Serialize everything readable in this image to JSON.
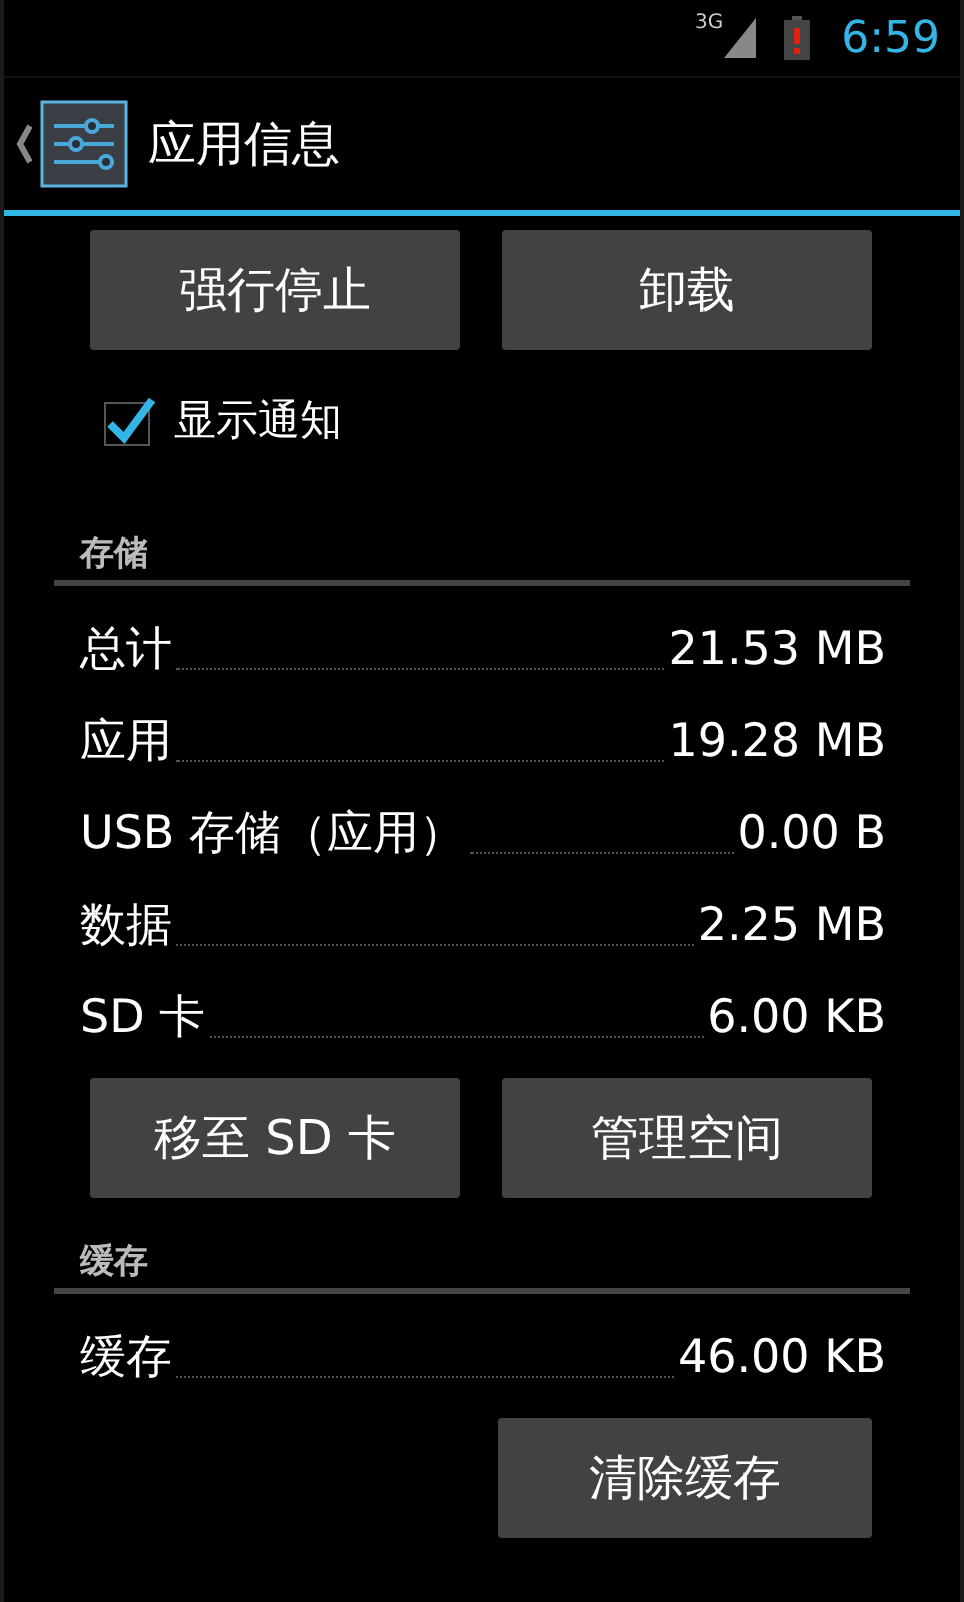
{
  "status_bar": {
    "network": "3G",
    "time": "6:59"
  },
  "action_bar": {
    "title": "应用信息"
  },
  "top_buttons": [
    {
      "label": "强行停止"
    },
    {
      "label": "卸载"
    }
  ],
  "notification_checkbox": {
    "label": "显示通知",
    "checked": true
  },
  "storage": {
    "header": "存储",
    "rows": [
      {
        "label": "总计",
        "value": "21.53 MB"
      },
      {
        "label": "应用",
        "value": "19.28 MB"
      },
      {
        "label": "USB 存储（应用）",
        "value": "0.00 B"
      },
      {
        "label": "数据",
        "value": "2.25 MB"
      },
      {
        "label": "SD 卡",
        "value": "6.00 KB"
      }
    ],
    "buttons": [
      {
        "label": "移至 SD 卡"
      },
      {
        "label": "管理空间"
      }
    ]
  },
  "cache": {
    "header": "缓存",
    "rows": [
      {
        "label": "缓存",
        "value": "46.00 KB"
      }
    ],
    "buttons": [
      {
        "label": "清除缓存"
      }
    ]
  }
}
